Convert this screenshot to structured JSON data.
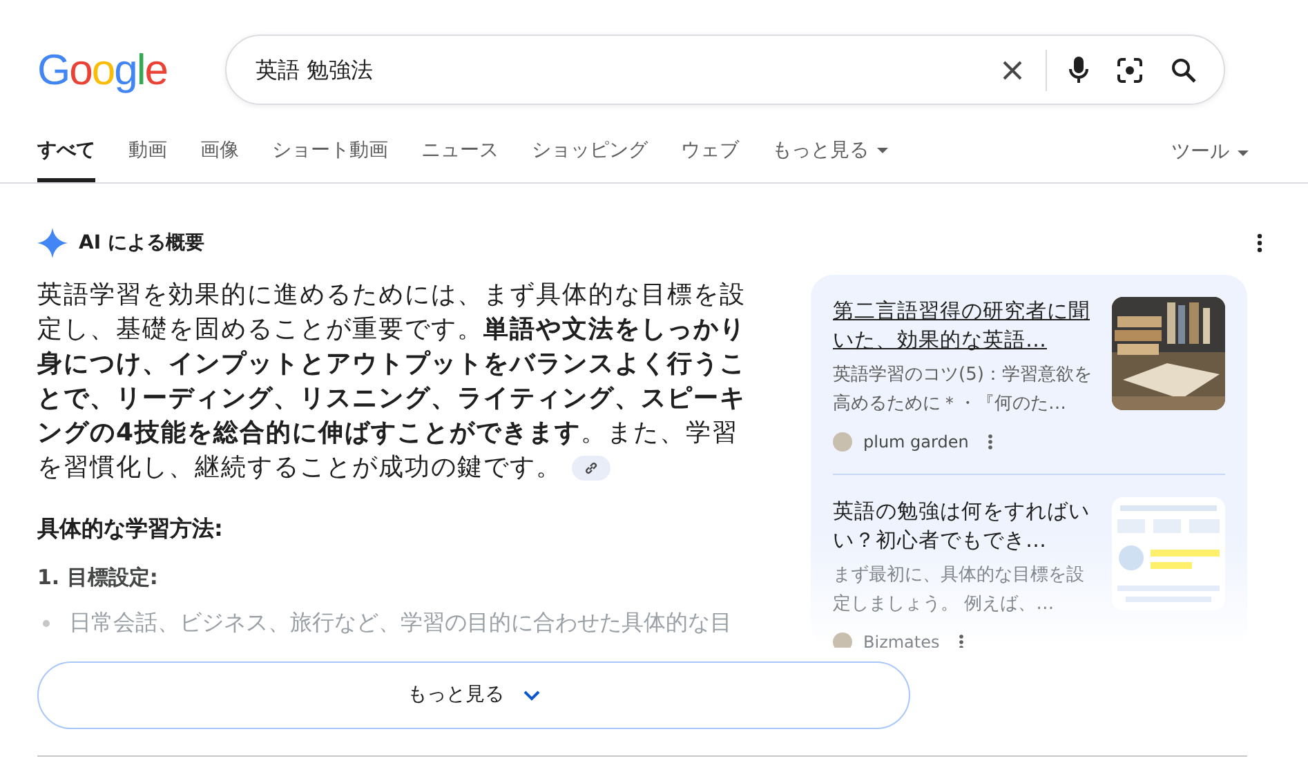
{
  "logo": "Google",
  "search": {
    "value": "英語 勉強法"
  },
  "tabs": [
    {
      "label": "すべて",
      "selected": true,
      "dropdown": false
    },
    {
      "label": "動画",
      "selected": false,
      "dropdown": false
    },
    {
      "label": "画像",
      "selected": false,
      "dropdown": false
    },
    {
      "label": "ショート動画",
      "selected": false,
      "dropdown": false
    },
    {
      "label": "ニュース",
      "selected": false,
      "dropdown": false
    },
    {
      "label": "ショッピング",
      "selected": false,
      "dropdown": false
    },
    {
      "label": "ウェブ",
      "selected": false,
      "dropdown": false
    },
    {
      "label": "もっと見る",
      "selected": false,
      "dropdown": true
    }
  ],
  "tools": {
    "label": "ツール"
  },
  "ai_overview": {
    "title": "AI による概要",
    "paragraph": "英語学習を効果的に進めるためには、まず具体的な目標を設定し、基礎を固めることが重要です。**単語や文法をしっかり身につけ、インプットとアウトプットをバランスよく行うことで、リーディング、リスニング、ライティング、スピーキングの4技能を総合的に伸ばすことができます**。また、学習を習慣化し、継続することが成功の鍵です。",
    "heading": "具体的な学習方法:",
    "subheading": "1. 目標設定:",
    "bullet": "日常会話、ビジネス、旅行など、学習の目的に合わせた具体的な目",
    "more_button": "もっと見る"
  },
  "sources": [
    {
      "title": "第二言語習得の研究者に聞いた、効果的な英語…",
      "snippet": "英語学習のコツ(5)：学習意欲を高めるために＊・『何のた…",
      "site": "plum garden",
      "underlined": true,
      "faded": false
    },
    {
      "title": "英語の勉強は何をすればいい？初心者でもでき…",
      "snippet": "まず最初に、具体的な目標を設定しましょう。 例えば、…",
      "site": "Bizmates",
      "underlined": false,
      "faded": true
    }
  ]
}
